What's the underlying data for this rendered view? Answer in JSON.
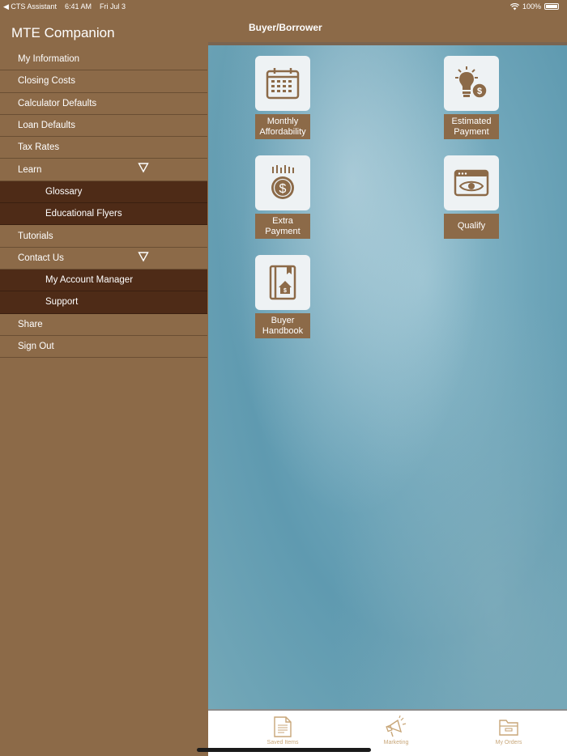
{
  "status_bar": {
    "back_app": "◀ CTS Assistant",
    "time": "6:41 AM",
    "date": "Fri Jul 3",
    "battery": "100%"
  },
  "sidebar": {
    "title": "MTE Companion",
    "items": [
      {
        "label": "My Information",
        "type": "item"
      },
      {
        "label": "Closing Costs",
        "type": "item"
      },
      {
        "label": "Calculator Defaults",
        "type": "item"
      },
      {
        "label": "Loan Defaults",
        "type": "item"
      },
      {
        "label": "Tax Rates",
        "type": "item"
      },
      {
        "label": "Learn",
        "type": "item",
        "expanded": true
      },
      {
        "label": "Glossary",
        "type": "sub"
      },
      {
        "label": "Educational Flyers",
        "type": "sub"
      },
      {
        "label": "Tutorials",
        "type": "item"
      },
      {
        "label": "Contact Us",
        "type": "item",
        "expanded": true
      },
      {
        "label": "My Account Manager",
        "type": "sub"
      },
      {
        "label": "Support",
        "type": "sub"
      },
      {
        "label": "Share",
        "type": "item"
      },
      {
        "label": "Sign Out",
        "type": "item"
      }
    ]
  },
  "header": {
    "title": "Buyer/Borrower"
  },
  "tiles": [
    {
      "line1": "Monthly",
      "line2": "Affordability",
      "icon": "calendar-icon"
    },
    {
      "line1": "Estimated",
      "line2": "Payment",
      "icon": "lightbulb-dollar-icon"
    },
    {
      "line1": "Extra",
      "line2": "Payment",
      "icon": "dollar-coin-icon"
    },
    {
      "line1": "Qualify",
      "line2": "",
      "icon": "eye-window-icon"
    },
    {
      "line1": "Buyer",
      "line2": "Handbook",
      "icon": "house-book-icon"
    }
  ],
  "tabbar": {
    "tabs": [
      {
        "label": "Saved Items",
        "icon": "document-icon"
      },
      {
        "label": "Marketing",
        "icon": "megaphone-icon"
      },
      {
        "label": "My Orders",
        "icon": "folder-icon"
      }
    ]
  },
  "colors": {
    "brown": "#8c6a48",
    "dark_brown": "#4e2b17",
    "tab_label": "#c8a678"
  }
}
